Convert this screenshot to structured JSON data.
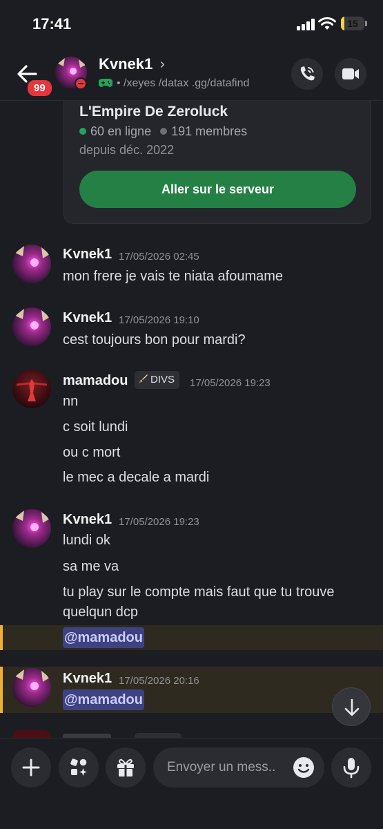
{
  "status_bar": {
    "time": "17:41",
    "battery": "15",
    "battery_fraction": 0.15
  },
  "header": {
    "unread_badge": "99",
    "username": "Kvnek1",
    "activity": "• /xeyes /datax .gg/datafind"
  },
  "server_card": {
    "name": "L'Empire De Zeroluck",
    "online": "60 en ligne",
    "members": "191 membres",
    "since": "depuis déc. 2022",
    "button": "Aller sur le serveur"
  },
  "messages": [
    {
      "author": "Kvnek1",
      "time": "17/05/2026 02:45",
      "lines": [
        "mon frere je vais te niata afoumame"
      ]
    },
    {
      "author": "Kvnek1",
      "time": "17/05/2026 19:10",
      "lines": [
        "cest toujours bon pour mardi?"
      ]
    },
    {
      "author": "mamadou",
      "tag": "DIVS",
      "time": "17/05/2026 19:23",
      "lines": [
        "nn",
        "c soit lundi",
        "ou c mort",
        "le mec a decale a mardi"
      ]
    },
    {
      "author": "Kvnek1",
      "time": "17/05/2026 19:23",
      "lines": [
        "lundi ok",
        "sa me va",
        "tu play sur le compte mais faut que tu trouve",
        "quelqun dcp"
      ],
      "mention": "@mamadou"
    },
    {
      "author": "Kvnek1",
      "time": "17/05/2026 20:16",
      "lines": [],
      "mention": "@mamadou"
    }
  ],
  "composer": {
    "placeholder": "Envoyer un mess.."
  },
  "colors": {
    "accent_green": "#248045",
    "mention_bg": "#3f4281",
    "highlight_bar": "#f0b132",
    "dnd_red": "#e5353d"
  }
}
